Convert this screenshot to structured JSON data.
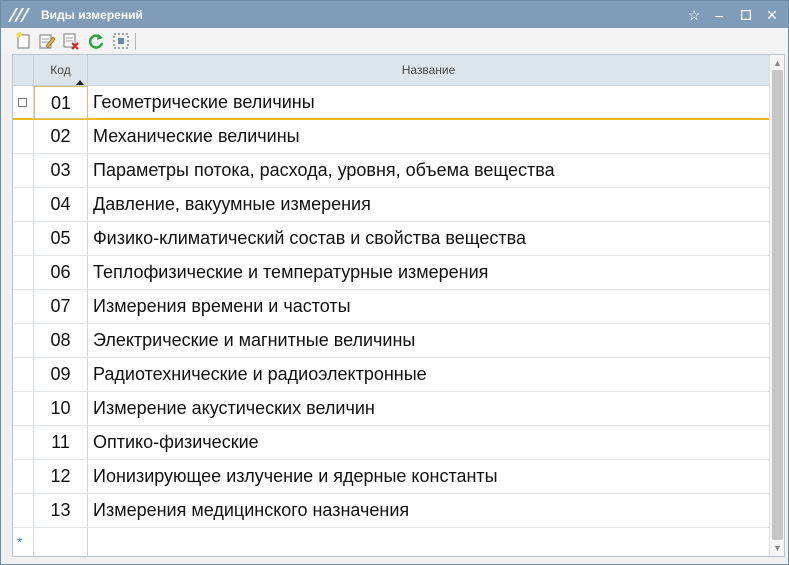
{
  "window": {
    "title": "Виды измерений",
    "favorite_icon": "star-outline-icon",
    "minimize_icon": "minimize-icon",
    "maximize_icon": "maximize-icon",
    "close_icon": "close-icon"
  },
  "toolbar": {
    "buttons": [
      {
        "name": "create-icon"
      },
      {
        "name": "edit-icon"
      },
      {
        "name": "mark-delete-icon"
      },
      {
        "name": "refresh-icon"
      },
      {
        "name": "select-area-icon"
      }
    ]
  },
  "table": {
    "columns": {
      "code": "Код",
      "name": "Название"
    },
    "rows": [
      {
        "code": "01",
        "name": "Геометрические величины"
      },
      {
        "code": "02",
        "name": "Механические величины"
      },
      {
        "code": "03",
        "name": "Параметры потока, расхода, уровня, объема вещества"
      },
      {
        "code": "04",
        "name": "Давление, вакуумные измерения"
      },
      {
        "code": "05",
        "name": "Физико-климатический состав и свойства вещества"
      },
      {
        "code": "06",
        "name": "Теплофизические и температурные измерения"
      },
      {
        "code": "07",
        "name": "Измерения времени и частоты"
      },
      {
        "code": "08",
        "name": "Электрические и магнитные величины"
      },
      {
        "code": "09",
        "name": "Радиотехнические и радиоэлектронные"
      },
      {
        "code": "10",
        "name": "Измерение акустических величин"
      },
      {
        "code": "11",
        "name": "Оптико-физические"
      },
      {
        "code": "12",
        "name": "Ионизирующее излучение и ядерные константы"
      },
      {
        "code": "13",
        "name": "Измерения медицинского назначения"
      }
    ],
    "selected_row_code": "01",
    "new_row_marker": "*"
  },
  "colors": {
    "titlebar": "#7f9db9",
    "header": "#dde5ec",
    "selection_line": "#f3b71f",
    "new_row_star": "#2b7fd6"
  }
}
